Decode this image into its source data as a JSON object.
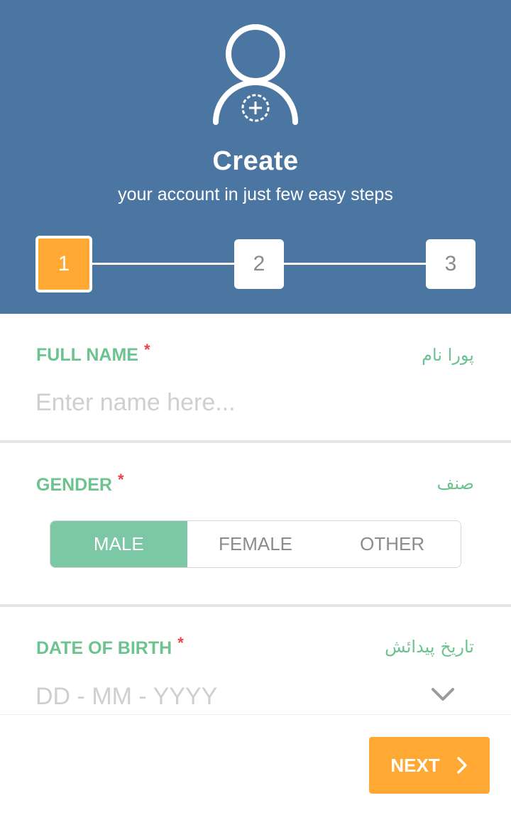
{
  "header": {
    "icon": "add-user-icon",
    "title": "Create",
    "subtitle": "your account in just few easy steps"
  },
  "steps": [
    {
      "label": "1",
      "active": true
    },
    {
      "label": "2",
      "active": false
    },
    {
      "label": "3",
      "active": false
    }
  ],
  "full_name": {
    "label": "FULL NAME",
    "required_mark": "*",
    "urdu_label": "پورا نام",
    "placeholder": "Enter name here...",
    "value": ""
  },
  "gender": {
    "label": "GENDER",
    "required_mark": "*",
    "urdu_label": "صنف",
    "options": [
      "MALE",
      "FEMALE",
      "OTHER"
    ],
    "selected": "MALE"
  },
  "date_of_birth": {
    "label": "DATE OF BIRTH",
    "required_mark": "*",
    "urdu_label": "تاریخ پیدائش",
    "placeholder": "DD - MM - YYYY"
  },
  "footer": {
    "next_label": "NEXT"
  },
  "colors": {
    "header_bg": "#4b76a2",
    "accent_orange": "#ffa834",
    "accent_green": "#6cc38f",
    "selected_segment": "#7cc7a4",
    "required": "#e8434a"
  }
}
